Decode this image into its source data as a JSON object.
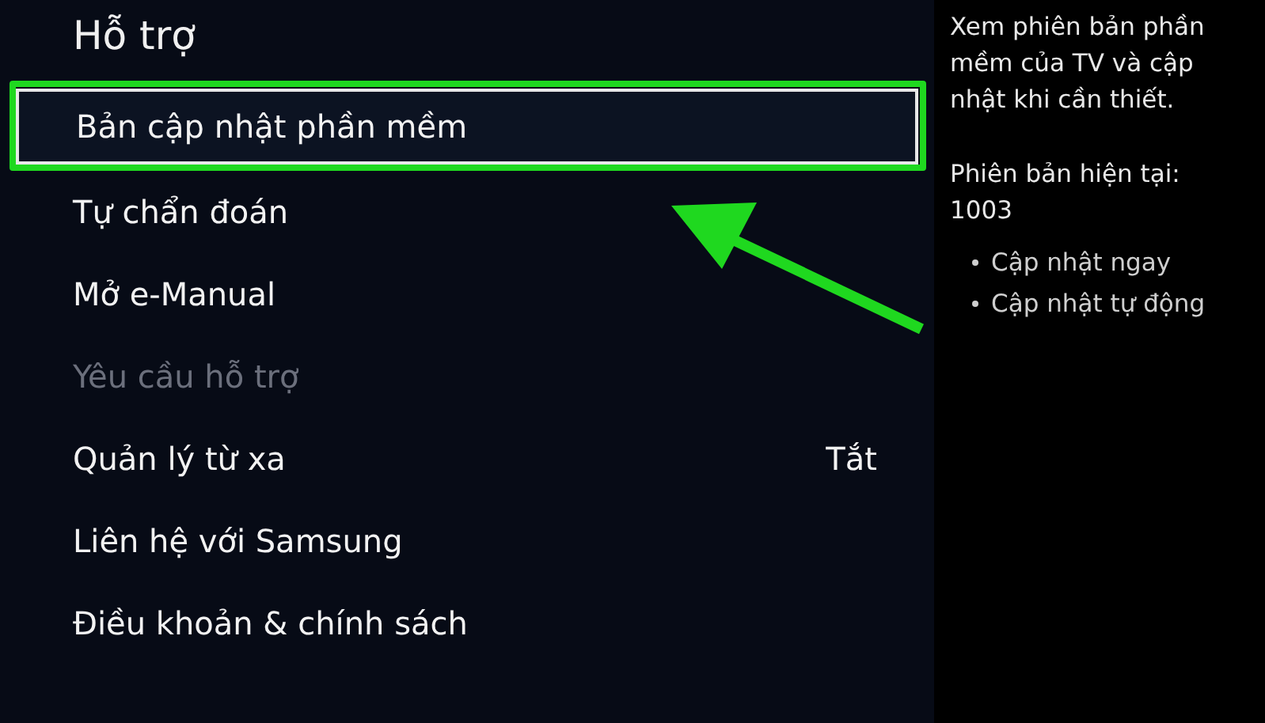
{
  "title": "Hỗ trợ",
  "menu": [
    {
      "label": "Bản cập nhật phần mềm",
      "selected": true,
      "disabled": false
    },
    {
      "label": "Tự chẩn đoán",
      "selected": false,
      "disabled": false
    },
    {
      "label": "Mở e-Manual",
      "selected": false,
      "disabled": false
    },
    {
      "label": "Yêu cầu hỗ trợ",
      "selected": false,
      "disabled": true
    },
    {
      "label": "Quản lý từ xa",
      "selected": false,
      "disabled": false,
      "value": "Tắt"
    },
    {
      "label": "Liên hệ với Samsung",
      "selected": false,
      "disabled": false
    },
    {
      "label": "Điều khoản & chính sách",
      "selected": false,
      "disabled": false
    }
  ],
  "info": {
    "description": "Xem phiên bản phần mềm của TV và cập nhật khi cần thiết.",
    "version_label": "Phiên bản hiện tại:",
    "version": "1003",
    "options": [
      "Cập nhật ngay",
      "Cập nhật tự động"
    ]
  },
  "annotation": {
    "highlight": true,
    "arrow": true
  }
}
